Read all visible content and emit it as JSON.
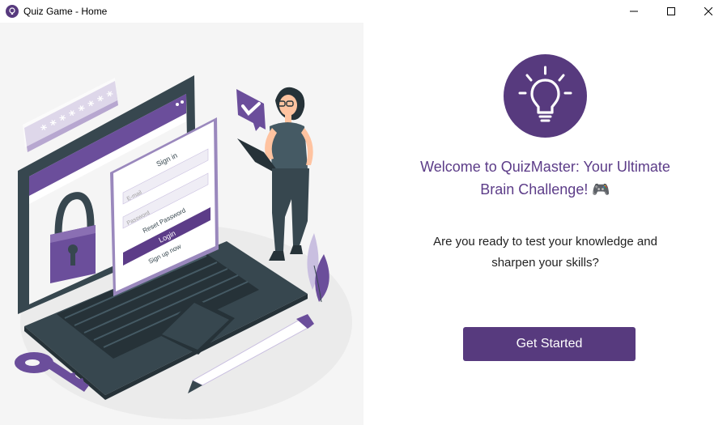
{
  "window": {
    "title": "Quiz Game - Home"
  },
  "illustration": {
    "password_mask": "* * * * * * * *",
    "form": {
      "heading": "Sign in",
      "email_placeholder": "E-mail",
      "password_placeholder": "Password",
      "reset_link": "Reset Password",
      "login_button": "Login",
      "signup_link": "Sign up now"
    }
  },
  "welcome": {
    "line1": "Welcome to QuizMaster: Your Ultimate",
    "line2": "Brain Challenge! 🎮"
  },
  "question": {
    "line1": "Are you ready to test your knowledge and",
    "line2": "sharpen your skills?"
  },
  "cta": {
    "label": "Get Started"
  },
  "colors": {
    "accent": "#573a7e",
    "heading": "#5c3c88",
    "illustration_purple": "#6b4e9b",
    "dark": "#37474f"
  }
}
